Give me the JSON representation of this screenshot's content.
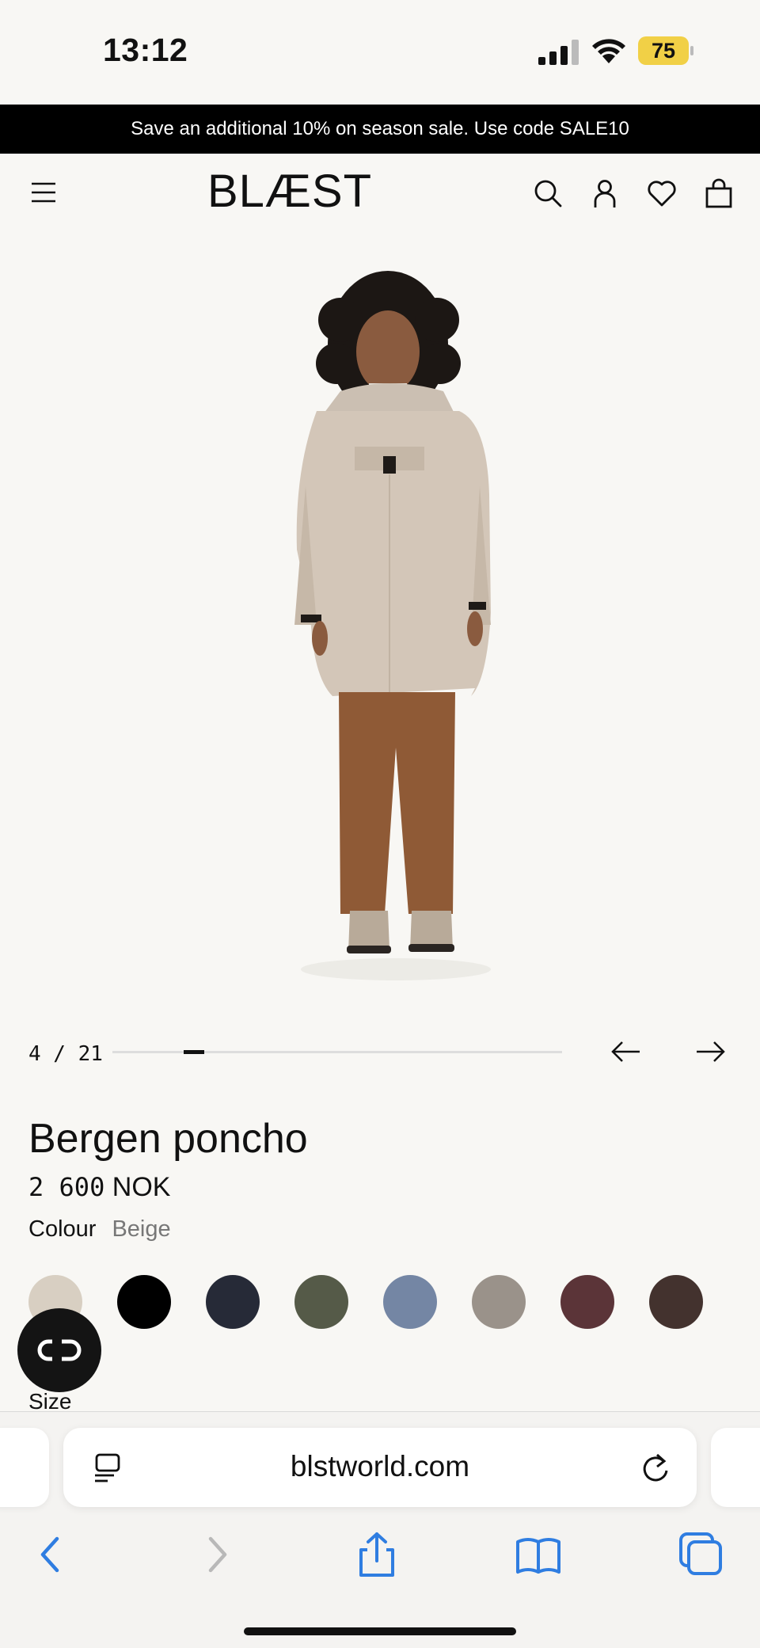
{
  "status_bar": {
    "time": "13:12",
    "battery": "75"
  },
  "promo": {
    "text": "Save an additional 10% on season sale. Use code SALE10"
  },
  "header": {
    "logo": "BLÆST"
  },
  "carousel": {
    "counter": "4 / 21",
    "current": 4,
    "total": 21
  },
  "product": {
    "title": "Bergen poncho",
    "price_amount": "2 600",
    "price_currency": "NOK",
    "colour_label": "Colour",
    "colour_value": "Beige",
    "size_label": "Size",
    "swatches": [
      {
        "name": "swatch-beige",
        "color": "#d8cfc2"
      },
      {
        "name": "swatch-black",
        "color": "#000000"
      },
      {
        "name": "swatch-navy",
        "color": "#262a37"
      },
      {
        "name": "swatch-olive",
        "color": "#555a48"
      },
      {
        "name": "swatch-blue",
        "color": "#7486a4"
      },
      {
        "name": "swatch-grey",
        "color": "#9a928a"
      },
      {
        "name": "swatch-burgundy",
        "color": "#5b3438"
      },
      {
        "name": "swatch-brown",
        "color": "#43322e"
      }
    ]
  },
  "browser": {
    "url": "blstworld.com"
  },
  "colors": {
    "background": "#f8f7f4",
    "promo_bg": "#000000",
    "battery": "#f1d046",
    "safari_blue": "#2f7de1"
  }
}
